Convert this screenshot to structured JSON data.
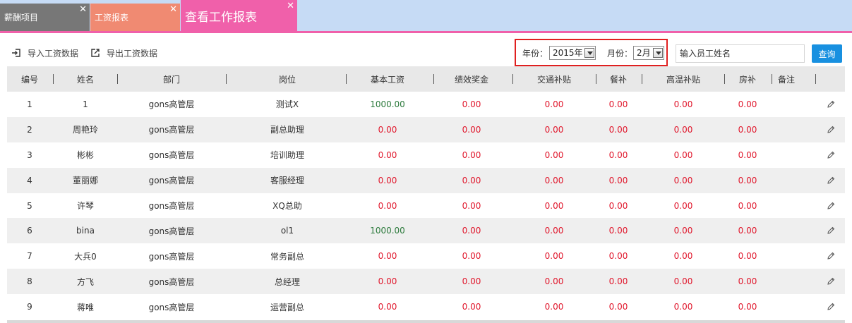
{
  "tabs": [
    {
      "label": "薪酬项目",
      "close": "✕"
    },
    {
      "label": "工资报表",
      "close": "✕"
    },
    {
      "label": "查看工作报表",
      "close": "✕"
    }
  ],
  "toolbar": {
    "import_label": "导入工资数据",
    "export_label": "导出工资数据"
  },
  "filters": {
    "year_label": "年份：",
    "year_value": "2015年",
    "month_label": "月份：",
    "month_value": "2月",
    "search_placeholder": "输入员工姓名",
    "search_button": "查询"
  },
  "colors": {
    "accent_pink": "#f060aa",
    "highlight_red": "#e02020",
    "value_red": "#e0162b",
    "value_green": "#2c7a3c",
    "button_blue": "#1890e0"
  },
  "table": {
    "columns": [
      "编号",
      "姓名",
      "部门",
      "岗位",
      "基本工资",
      "绩效奖金",
      "交通补贴",
      "餐补",
      "高温补贴",
      "房补",
      "备注"
    ],
    "rows": [
      {
        "id": "1",
        "name": "1",
        "dept": "gons高管层",
        "post": "测试X",
        "base": "1000.00",
        "bonus": "0.00",
        "traffic": "0.00",
        "meal": "0.00",
        "heat": "0.00",
        "house": "0.00",
        "note": ""
      },
      {
        "id": "2",
        "name": "周艳玲",
        "dept": "gons高管层",
        "post": "副总助理",
        "base": "0.00",
        "bonus": "0.00",
        "traffic": "0.00",
        "meal": "0.00",
        "heat": "0.00",
        "house": "0.00",
        "note": ""
      },
      {
        "id": "3",
        "name": "彬彬",
        "dept": "gons高管层",
        "post": "培训助理",
        "base": "0.00",
        "bonus": "0.00",
        "traffic": "0.00",
        "meal": "0.00",
        "heat": "0.00",
        "house": "0.00",
        "note": ""
      },
      {
        "id": "4",
        "name": "董丽娜",
        "dept": "gons高管层",
        "post": "客服经理",
        "base": "0.00",
        "bonus": "0.00",
        "traffic": "0.00",
        "meal": "0.00",
        "heat": "0.00",
        "house": "0.00",
        "note": ""
      },
      {
        "id": "5",
        "name": "许琴",
        "dept": "gons高管层",
        "post": "XQ总助",
        "base": "0.00",
        "bonus": "0.00",
        "traffic": "0.00",
        "meal": "0.00",
        "heat": "0.00",
        "house": "0.00",
        "note": ""
      },
      {
        "id": "6",
        "name": "bina",
        "dept": "gons高管层",
        "post": "ol1",
        "base": "1000.00",
        "bonus": "0.00",
        "traffic": "0.00",
        "meal": "0.00",
        "heat": "0.00",
        "house": "0.00",
        "note": ""
      },
      {
        "id": "7",
        "name": "大兵0",
        "dept": "gons高管层",
        "post": "常务副总",
        "base": "0.00",
        "bonus": "0.00",
        "traffic": "0.00",
        "meal": "0.00",
        "heat": "0.00",
        "house": "0.00",
        "note": ""
      },
      {
        "id": "8",
        "name": "方飞",
        "dept": "gons高管层",
        "post": "总经理",
        "base": "0.00",
        "bonus": "0.00",
        "traffic": "0.00",
        "meal": "0.00",
        "heat": "0.00",
        "house": "0.00",
        "note": ""
      },
      {
        "id": "9",
        "name": "蒋唯",
        "dept": "gons高管层",
        "post": "运营副总",
        "base": "0.00",
        "bonus": "0.00",
        "traffic": "0.00",
        "meal": "0.00",
        "heat": "0.00",
        "house": "0.00",
        "note": ""
      }
    ]
  }
}
